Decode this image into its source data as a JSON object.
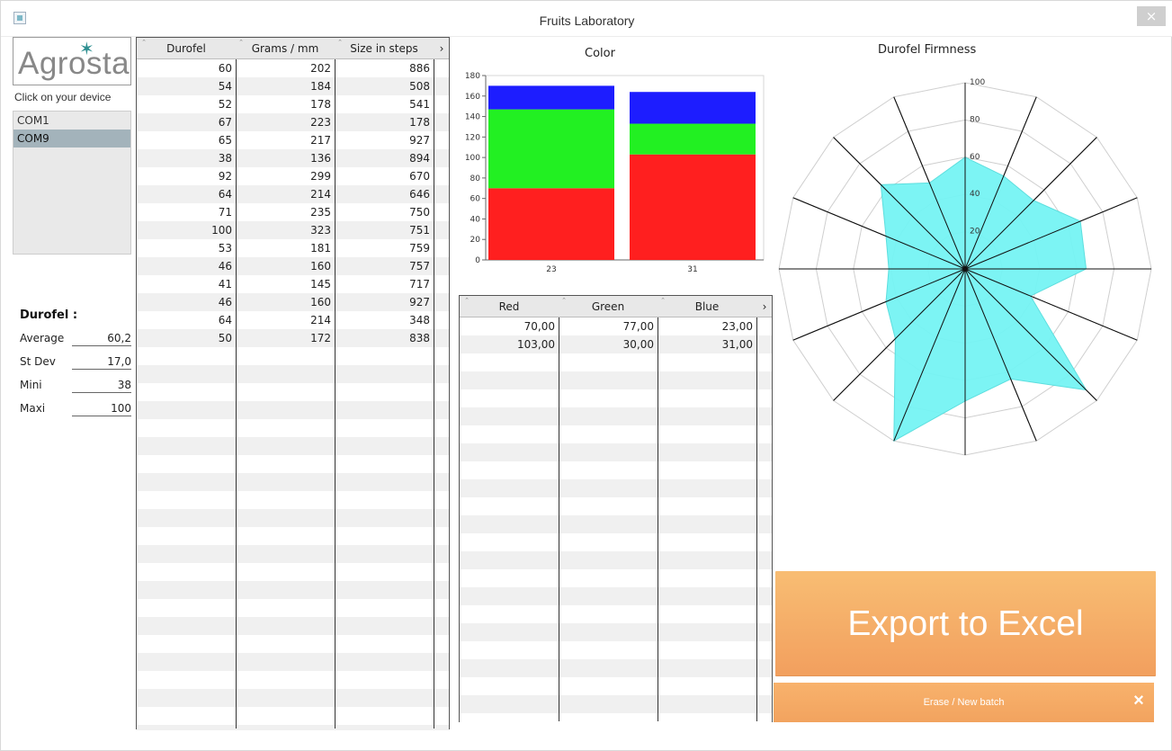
{
  "window": {
    "title": "Fruits Laboratory",
    "close_symbol": "×"
  },
  "sidebar": {
    "logo_text": "Agrosta",
    "device_prompt": "Click on your device",
    "devices": [
      {
        "label": "COM1",
        "selected": false
      },
      {
        "label": "COM9",
        "selected": true
      }
    ],
    "stats": {
      "title": "Durofel :",
      "rows": [
        {
          "label": "Average",
          "value": "60,2"
        },
        {
          "label": "St Dev",
          "value": "17,0"
        },
        {
          "label": "Mini",
          "value": "38"
        },
        {
          "label": "Maxi",
          "value": "100"
        }
      ]
    }
  },
  "measurements_table": {
    "headers": [
      "Durofel",
      "Grams / mm",
      "Size in steps"
    ],
    "rows": [
      [
        "60",
        "202",
        "886"
      ],
      [
        "54",
        "184",
        "508"
      ],
      [
        "52",
        "178",
        "541"
      ],
      [
        "67",
        "223",
        "178"
      ],
      [
        "65",
        "217",
        "927"
      ],
      [
        "38",
        "136",
        "894"
      ],
      [
        "92",
        "299",
        "670"
      ],
      [
        "64",
        "214",
        "646"
      ],
      [
        "71",
        "235",
        "750"
      ],
      [
        "100",
        "323",
        "751"
      ],
      [
        "53",
        "181",
        "759"
      ],
      [
        "46",
        "160",
        "757"
      ],
      [
        "41",
        "145",
        "717"
      ],
      [
        "46",
        "160",
        "927"
      ],
      [
        "64",
        "214",
        "348"
      ],
      [
        "50",
        "172",
        "838"
      ]
    ]
  },
  "color_table": {
    "headers": [
      "Red",
      "Green",
      "Blue"
    ],
    "rows": [
      [
        "70,00",
        "77,00",
        "23,00"
      ],
      [
        "103,00",
        "30,00",
        "31,00"
      ]
    ]
  },
  "chart_data": [
    {
      "type": "bar",
      "title": "Color",
      "categories": [
        "23",
        "31"
      ],
      "series": [
        {
          "name": "",
          "color": "#ff1f1f",
          "values": [
            70,
            103
          ]
        },
        {
          "name": "",
          "color": "#22f022",
          "values": [
            77,
            30
          ]
        },
        {
          "name": "",
          "color": "#1d1dff",
          "values": [
            23,
            31
          ]
        }
      ],
      "stacked": true,
      "ylim": [
        0,
        180
      ],
      "yticks": [
        0,
        20,
        40,
        60,
        80,
        100,
        120,
        140,
        160,
        180
      ],
      "grid": false
    },
    {
      "type": "radar",
      "title": "Durofel Firmness",
      "rlim": [
        0,
        100
      ],
      "rticks": [
        20,
        40,
        60,
        80,
        100
      ],
      "values": [
        60,
        54,
        52,
        67,
        65,
        38,
        92,
        64,
        71,
        100,
        53,
        46,
        41,
        46,
        64,
        50
      ],
      "fill_color": "#75f4f4",
      "grid": true
    }
  ],
  "actions": {
    "export_label": "Export to Excel",
    "erase_label": "Erase / New batch",
    "erase_icon": "×"
  }
}
